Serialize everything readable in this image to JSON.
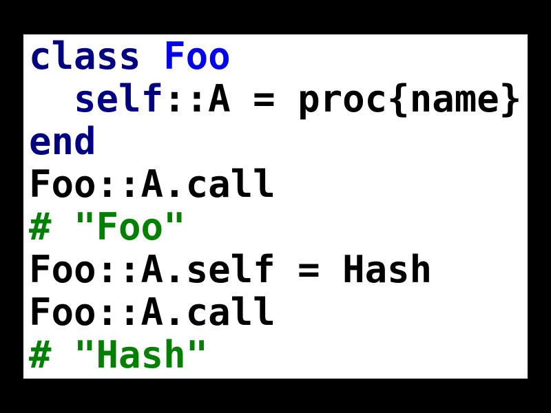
{
  "colors": {
    "background": "#000000",
    "panel": "#ffffff",
    "keyword": "#000080",
    "class_name": "#0000ee",
    "plain": "#000000",
    "comment": "#008000"
  },
  "code": {
    "line1": {
      "kw": "class",
      "sp": " ",
      "cls": "Foo"
    },
    "line2": {
      "indent": "  ",
      "kw": "self",
      "rest": "::A = proc{name}"
    },
    "line3": {
      "kw": "end"
    },
    "line4": {
      "text": "Foo::A.call"
    },
    "line5": {
      "comment": "# \"Foo\""
    },
    "line6": {
      "text": "Foo::A.self = Hash"
    },
    "line7": {
      "text": "Foo::A.call"
    },
    "line8": {
      "comment": "# \"Hash\""
    }
  }
}
